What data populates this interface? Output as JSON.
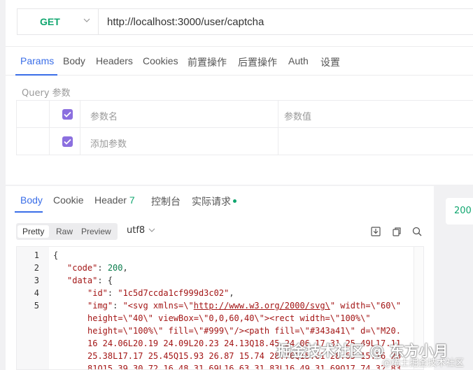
{
  "request": {
    "method": "GET",
    "url": "http://localhost:3000/user/captcha",
    "tabs": [
      "Params",
      "Body",
      "Headers",
      "Cookies",
      "前置操作",
      "后置操作",
      "Auth",
      "设置"
    ],
    "query_label": "Query 参数",
    "table": {
      "header_name": "参数名",
      "header_value": "参数值",
      "add_placeholder": "添加参数"
    }
  },
  "response": {
    "tabs": [
      "Body",
      "Cookie",
      "Header",
      "控制台",
      "实际请求"
    ],
    "header_count": "7",
    "view_modes": [
      "Pretty",
      "Raw",
      "Preview"
    ],
    "encoding": "utf8",
    "status": "200",
    "line_numbers": [
      "1",
      "2",
      "3",
      "4",
      "5"
    ],
    "code": {
      "l1": "{",
      "l2_key": "\"code\"",
      "l2_val": "200",
      "l3_key": "\"data\"",
      "l3_rest": ": {",
      "l4_key": "\"id\"",
      "l4_val": "\"1c5d7ccda1cf999d3c02\"",
      "l5_key": "\"img\"",
      "l5_val_a": "\"<svg xmlns=\\\"",
      "l5_url": "http://www.w3.org/2000/svg\\",
      "l5_val_b": "\" width=\\\"60\\\"",
      "w1": "height=\\\"40\\\" viewBox=\\\"0,0,60,40\\\"><rect width=\\\"100%\\\"",
      "w2": "height=\\\"100%\\\" fill=\\\"#999\\\"/><path fill=\\\"#343a41\\\" d=\\\"M20.",
      "w3": "16 24.06L20.19 24.09L20.23 24.13Q18.45 24.06 17.31 25.49L17.11",
      "w4": "25.38L17.17 25.45Q15.93 26.87 15.74 28.76Q15.61 28.65 15.76 28",
      "w5": "81Q15.39 30.72 16.48 31.69L16.63 31.83L16.49 31.69Q17.74 32.83"
    }
  },
  "watermark": {
    "main": "掘金技术社区 @ 东方小月",
    "sub": "@稀土掘金技术社区"
  },
  "colors": {
    "accent": "#3a6ee8",
    "method_green": "#10a66f",
    "checkbox": "#8b6fdf"
  }
}
